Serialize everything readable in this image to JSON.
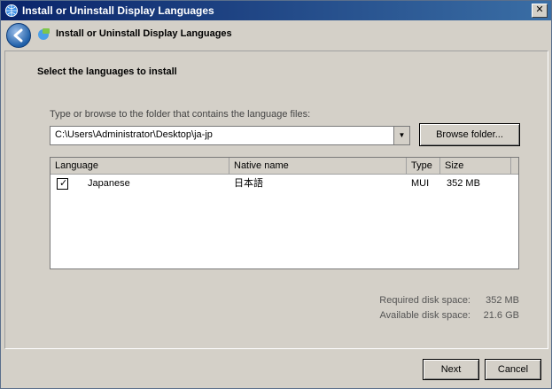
{
  "window": {
    "title": "Install or Uninstall Display Languages"
  },
  "header": {
    "title": "Install or Uninstall Display Languages"
  },
  "content": {
    "heading": "Select the languages to install",
    "path_label": "Type or browse to the folder that contains the language files:",
    "path_value": "C:\\Users\\Administrator\\Desktop\\ja-jp",
    "browse_label": "Browse folder..."
  },
  "list": {
    "columns": [
      "Language",
      "Native name",
      "Type",
      "Size"
    ],
    "rows": [
      {
        "checked": true,
        "language": "Japanese",
        "native": "日本語",
        "type": "MUI",
        "size": "352 MB"
      }
    ]
  },
  "disk": {
    "required_label": "Required disk space:",
    "required_value": "352 MB",
    "available_label": "Available disk space:",
    "available_value": "21.6 GB"
  },
  "buttons": {
    "next": "Next",
    "cancel": "Cancel"
  },
  "colors": {
    "titlebar": "#0a246a",
    "face": "#d4d0c8"
  },
  "icons": {
    "title": "language-globe-icon",
    "back": "back-arrow-icon",
    "header": "language-globe-icon",
    "close": "close-icon"
  }
}
